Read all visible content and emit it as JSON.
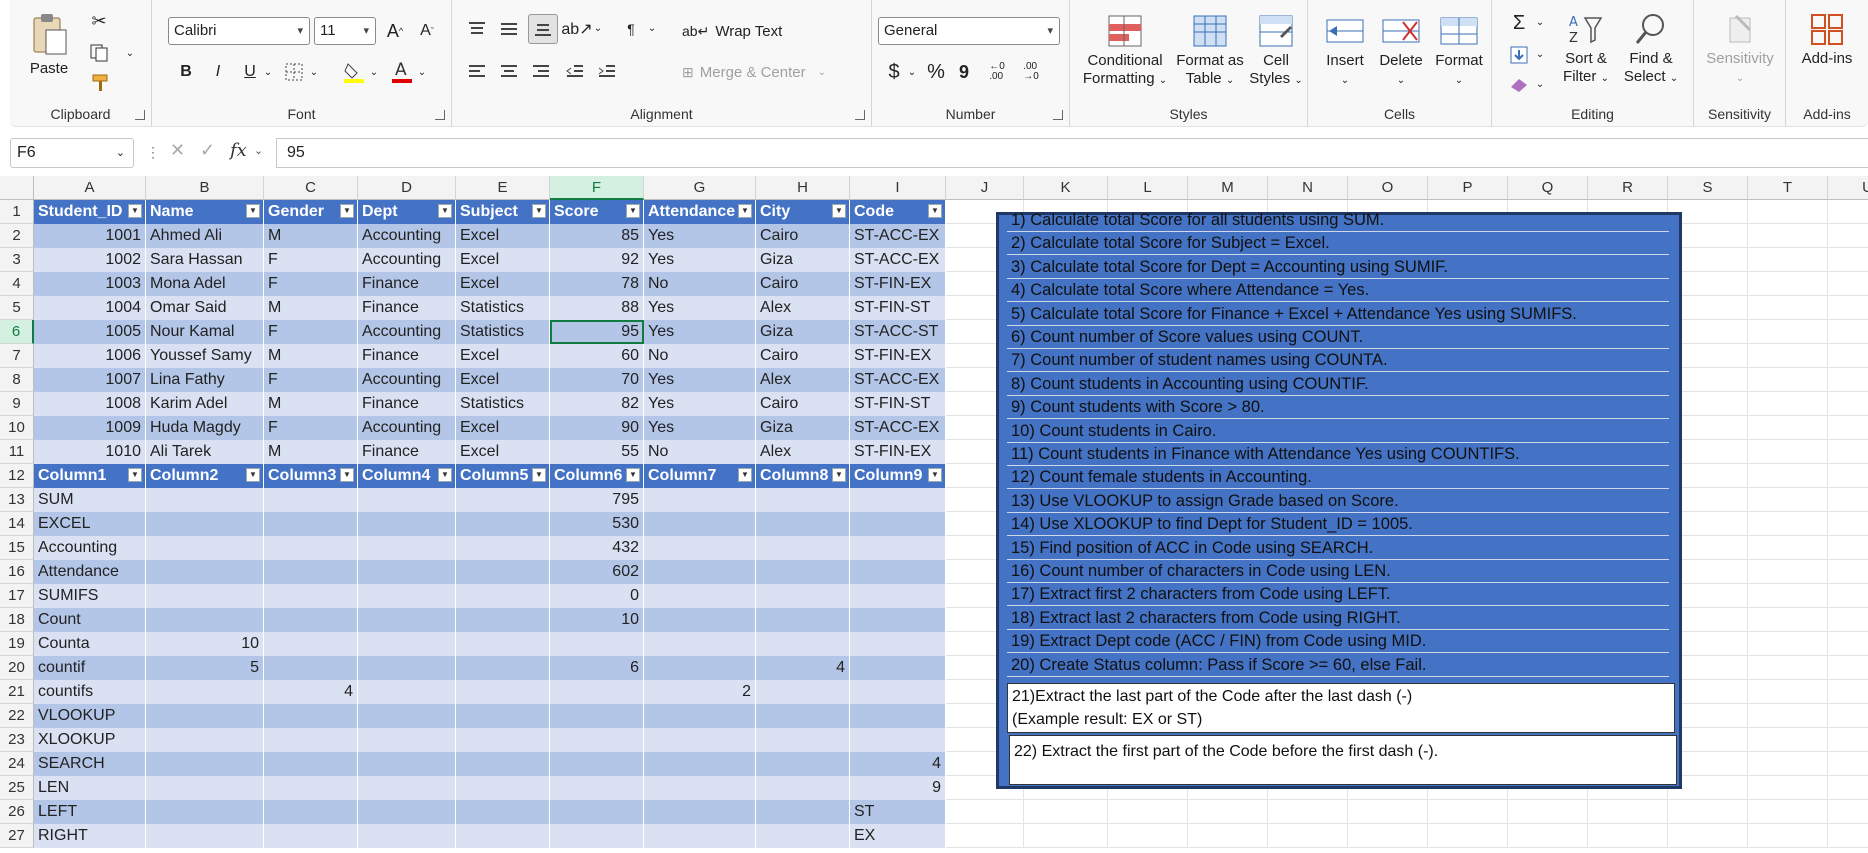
{
  "ribbon": {
    "clipboard": {
      "label": "Clipboard",
      "paste": "Paste"
    },
    "font": {
      "label": "Font",
      "name": "Calibri",
      "size": "11",
      "bold": "B",
      "italic": "I",
      "underline": "U"
    },
    "alignment": {
      "label": "Alignment",
      "wrap": "Wrap Text",
      "merge": "Merge & Center"
    },
    "number": {
      "label": "Number",
      "format": "General",
      "currency": "$",
      "percent": "%",
      "comma": "9"
    },
    "styles": {
      "label": "Styles",
      "conditional_line1": "Conditional",
      "conditional_line2": "Formatting",
      "format_table_line1": "Format as",
      "format_table_line2": "Table",
      "cell_styles_line1": "Cell",
      "cell_styles_line2": "Styles"
    },
    "cells": {
      "label": "Cells",
      "insert": "Insert",
      "delete": "Delete",
      "format": "Format"
    },
    "editing": {
      "label": "Editing",
      "sort_line1": "Sort &",
      "sort_line2": "Filter",
      "find_line1": "Find &",
      "find_line2": "Select"
    },
    "sensitivity": {
      "label": "Sensitivity",
      "button": "Sensitivity"
    },
    "addins": {
      "label": "Add-ins",
      "button": "Add-ins"
    }
  },
  "formula_bar": {
    "name_box": "F6",
    "fx": "fx",
    "value": "95"
  },
  "columns": [
    "A",
    "B",
    "C",
    "D",
    "E",
    "F",
    "G",
    "H",
    "I",
    "J",
    "K",
    "L",
    "M",
    "N",
    "O",
    "P",
    "Q",
    "R",
    "S",
    "T",
    "U"
  ],
  "selected_column": "F",
  "selected_row": 6,
  "rows": [
    {
      "n": "1",
      "cells": [
        "Student_ID",
        "Name",
        "Gender",
        "Dept",
        "Subject",
        "Score",
        "Attendance",
        "City",
        "Code"
      ]
    },
    {
      "n": "2",
      "cells": [
        "1001",
        "Ahmed Ali",
        "M",
        "Accounting",
        "Excel",
        "85",
        "Yes",
        "Cairo",
        "ST-ACC-EX"
      ]
    },
    {
      "n": "3",
      "cells": [
        "1002",
        "Sara Hassan",
        "F",
        "Accounting",
        "Excel",
        "92",
        "Yes",
        "Giza",
        "ST-ACC-EX"
      ]
    },
    {
      "n": "4",
      "cells": [
        "1003",
        "Mona Adel",
        "F",
        "Finance",
        "Excel",
        "78",
        "No",
        "Cairo",
        "ST-FIN-EX"
      ]
    },
    {
      "n": "5",
      "cells": [
        "1004",
        "Omar Said",
        "M",
        "Finance",
        "Statistics",
        "88",
        "Yes",
        "Alex",
        "ST-FIN-ST"
      ]
    },
    {
      "n": "6",
      "cells": [
        "1005",
        "Nour Kamal",
        "F",
        "Accounting",
        "Statistics",
        "95",
        "Yes",
        "Giza",
        "ST-ACC-ST"
      ]
    },
    {
      "n": "7",
      "cells": [
        "1006",
        "Youssef Samy",
        "M",
        "Finance",
        "Excel",
        "60",
        "No",
        "Cairo",
        "ST-FIN-EX"
      ]
    },
    {
      "n": "8",
      "cells": [
        "1007",
        "Lina Fathy",
        "F",
        "Accounting",
        "Excel",
        "70",
        "Yes",
        "Alex",
        "ST-ACC-EX"
      ]
    },
    {
      "n": "9",
      "cells": [
        "1008",
        "Karim Adel",
        "M",
        "Finance",
        "Statistics",
        "82",
        "Yes",
        "Cairo",
        "ST-FIN-ST"
      ]
    },
    {
      "n": "10",
      "cells": [
        "1009",
        "Huda Magdy",
        "F",
        "Accounting",
        "Excel",
        "90",
        "Yes",
        "Giza",
        "ST-ACC-EX"
      ]
    },
    {
      "n": "11",
      "cells": [
        "1010",
        "Ali Tarek",
        "M",
        "Finance",
        "Excel",
        "55",
        "No",
        "Alex",
        "ST-FIN-EX"
      ]
    },
    {
      "n": "12",
      "cells": [
        "Column1",
        "Column2",
        "Column3",
        "Column4",
        "Column5",
        "Column6",
        "Column7",
        "Column8",
        "Column9"
      ]
    },
    {
      "n": "13",
      "cells": [
        "SUM",
        "",
        "",
        "",
        "",
        "795",
        "",
        "",
        ""
      ]
    },
    {
      "n": "14",
      "cells": [
        "EXCEL",
        "",
        "",
        "",
        "",
        "530",
        "",
        "",
        ""
      ]
    },
    {
      "n": "15",
      "cells": [
        "Accounting",
        "",
        "",
        "",
        "",
        "432",
        "",
        "",
        ""
      ]
    },
    {
      "n": "16",
      "cells": [
        "Attendance",
        "",
        "",
        "",
        "",
        "602",
        "",
        "",
        ""
      ]
    },
    {
      "n": "17",
      "cells": [
        "SUMIFS",
        "",
        "",
        "",
        "",
        "0",
        "",
        "",
        ""
      ]
    },
    {
      "n": "18",
      "cells": [
        "Count",
        "",
        "",
        "",
        "",
        "10",
        "",
        "",
        ""
      ]
    },
    {
      "n": "19",
      "cells": [
        "Counta",
        "10",
        "",
        "",
        "",
        "",
        "",
        "",
        ""
      ]
    },
    {
      "n": "20",
      "cells": [
        "countif",
        "5",
        "",
        "",
        "",
        "6",
        "",
        "4",
        ""
      ]
    },
    {
      "n": "21",
      "cells": [
        "countifs",
        "",
        "4",
        "",
        "",
        "",
        "2",
        "",
        ""
      ]
    },
    {
      "n": "22",
      "cells": [
        "VLOOKUP",
        "",
        "",
        "",
        "",
        "",
        "",
        "",
        ""
      ]
    },
    {
      "n": "23",
      "cells": [
        "XLOOKUP",
        "",
        "",
        "",
        "",
        "",
        "",
        "",
        ""
      ]
    },
    {
      "n": "24",
      "cells": [
        "SEARCH",
        "",
        "",
        "",
        "",
        "",
        "",
        "",
        "4"
      ]
    },
    {
      "n": "25",
      "cells": [
        "LEN",
        "",
        "",
        "",
        "",
        "",
        "",
        "",
        "9"
      ]
    },
    {
      "n": "26",
      "cells": [
        "LEFT",
        "",
        "",
        "",
        "",
        "",
        "",
        "",
        "ST"
      ]
    },
    {
      "n": "27",
      "cells": [
        "RIGHT",
        "",
        "",
        "",
        "",
        "",
        "",
        "",
        "EX"
      ]
    }
  ],
  "instructions": [
    "1) Calculate total Score for all students using SUM.",
    "2) Calculate total Score for Subject = Excel.",
    "3) Calculate total Score for Dept = Accounting using SUMIF.",
    "4) Calculate total Score where Attendance = Yes.",
    "5) Calculate total Score for Finance + Excel + Attendance Yes using SUMIFS.",
    "6) Count number of Score values using COUNT.",
    "7) Count number of student names using COUNTA.",
    "8) Count students in Accounting using COUNTIF.",
    "9) Count students with Score > 80.",
    "10) Count students in Cairo.",
    "11) Count students in Finance with Attendance Yes using COUNTIFS.",
    "12) Count female students in Accounting.",
    "13) Use VLOOKUP to assign Grade based on Score.",
    "14) Use XLOOKUP to find Dept for Student_ID = 1005.",
    "15) Find position of ACC in Code using SEARCH.",
    "16) Count number of characters in Code using LEN.",
    "17) Extract first 2 characters from Code using LEFT.",
    "18) Extract last 2 characters from Code using RIGHT.",
    "19) Extract Dept code (ACC / FIN) from Code using MID.",
    "20) Create Status column: Pass if Score >= 60, else Fail."
  ],
  "extra_instructions": {
    "q21_line1": "21)Extract the last part of the Code after the last dash (-)",
    "q21_line2": "(Example result: EX or ST)",
    "q22": "22) Extract the first part of the Code before the first dash (-)."
  },
  "colors": {
    "header_blue": "#4472c4",
    "band_light": "#d9e1f2",
    "band_dark": "#b4c6e7",
    "selection_green": "#107c41"
  }
}
